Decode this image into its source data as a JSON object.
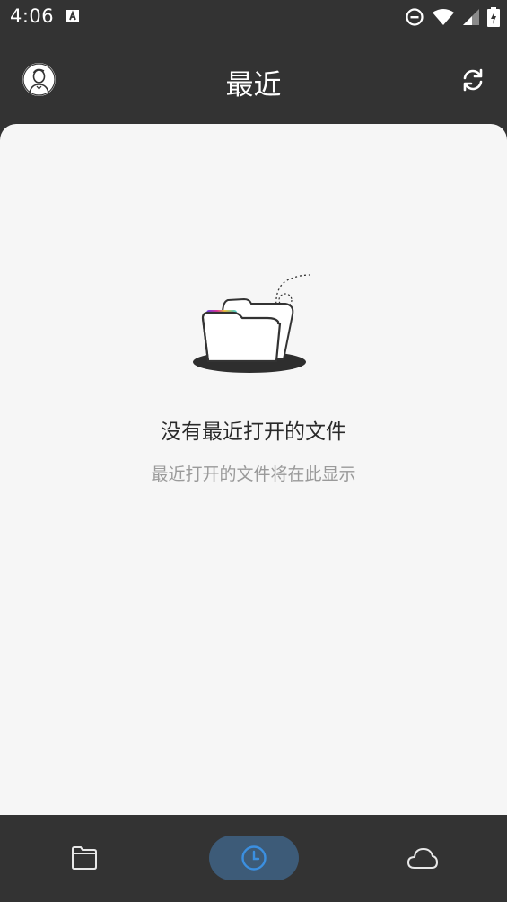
{
  "status_bar": {
    "time": "4:06"
  },
  "app_bar": {
    "title": "最近"
  },
  "empty_state": {
    "title": "没有最近打开的文件",
    "subtitle": "最近打开的文件将在此显示"
  },
  "bottom_nav": {
    "items": [
      {
        "icon": "folder-icon",
        "selected": false
      },
      {
        "icon": "clock-icon",
        "selected": true
      },
      {
        "icon": "cloud-icon",
        "selected": false
      }
    ]
  },
  "colors": {
    "app_background": "#333333",
    "content_background": "#f6f6f6",
    "selected_tab": "#3d5b78",
    "selected_icon": "#3b8fe0"
  }
}
